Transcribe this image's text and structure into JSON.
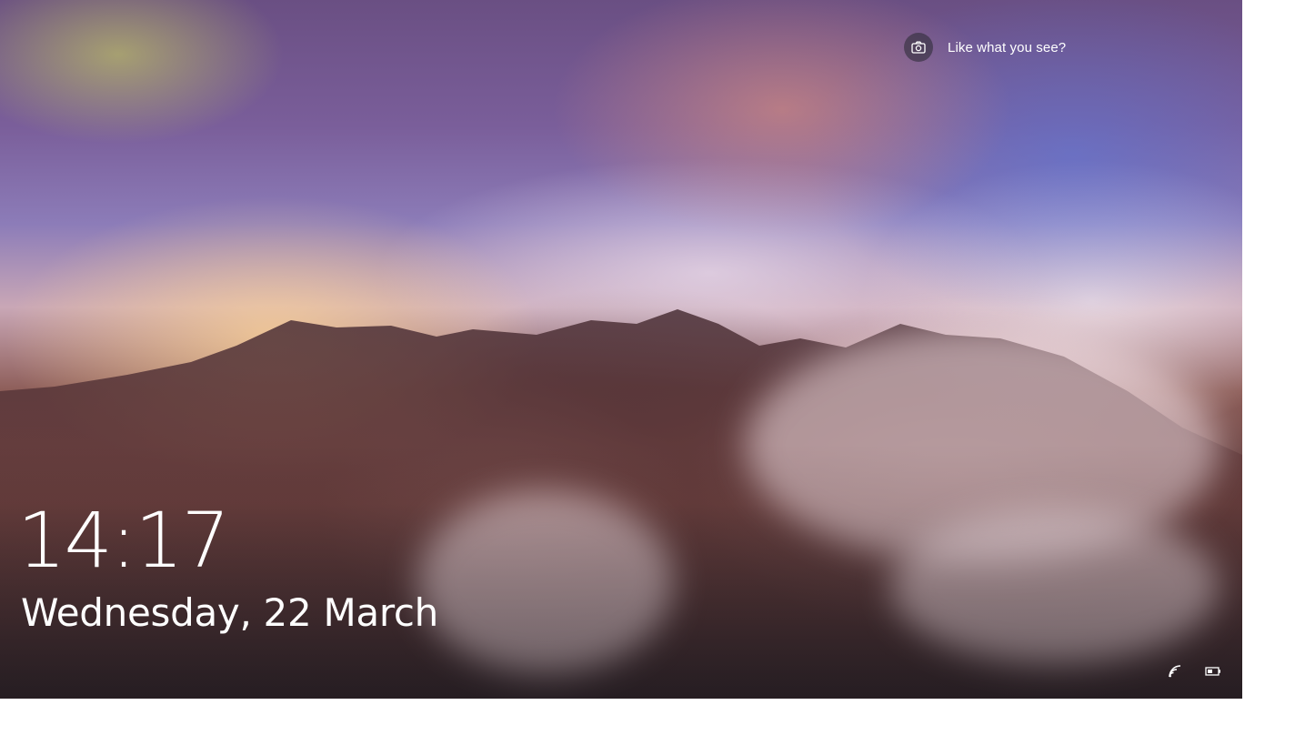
{
  "lockscreen": {
    "spotlight": {
      "icon": "camera-icon",
      "label": "Like what you see?"
    },
    "clock": {
      "time": "14:17",
      "date": "Wednesday, 22 March"
    },
    "tray": {
      "network_icon": "wifi-signal-icon",
      "battery_icon": "battery-icon"
    }
  },
  "colors": {
    "text": "#ffffff",
    "camera_badge": "#282832"
  }
}
